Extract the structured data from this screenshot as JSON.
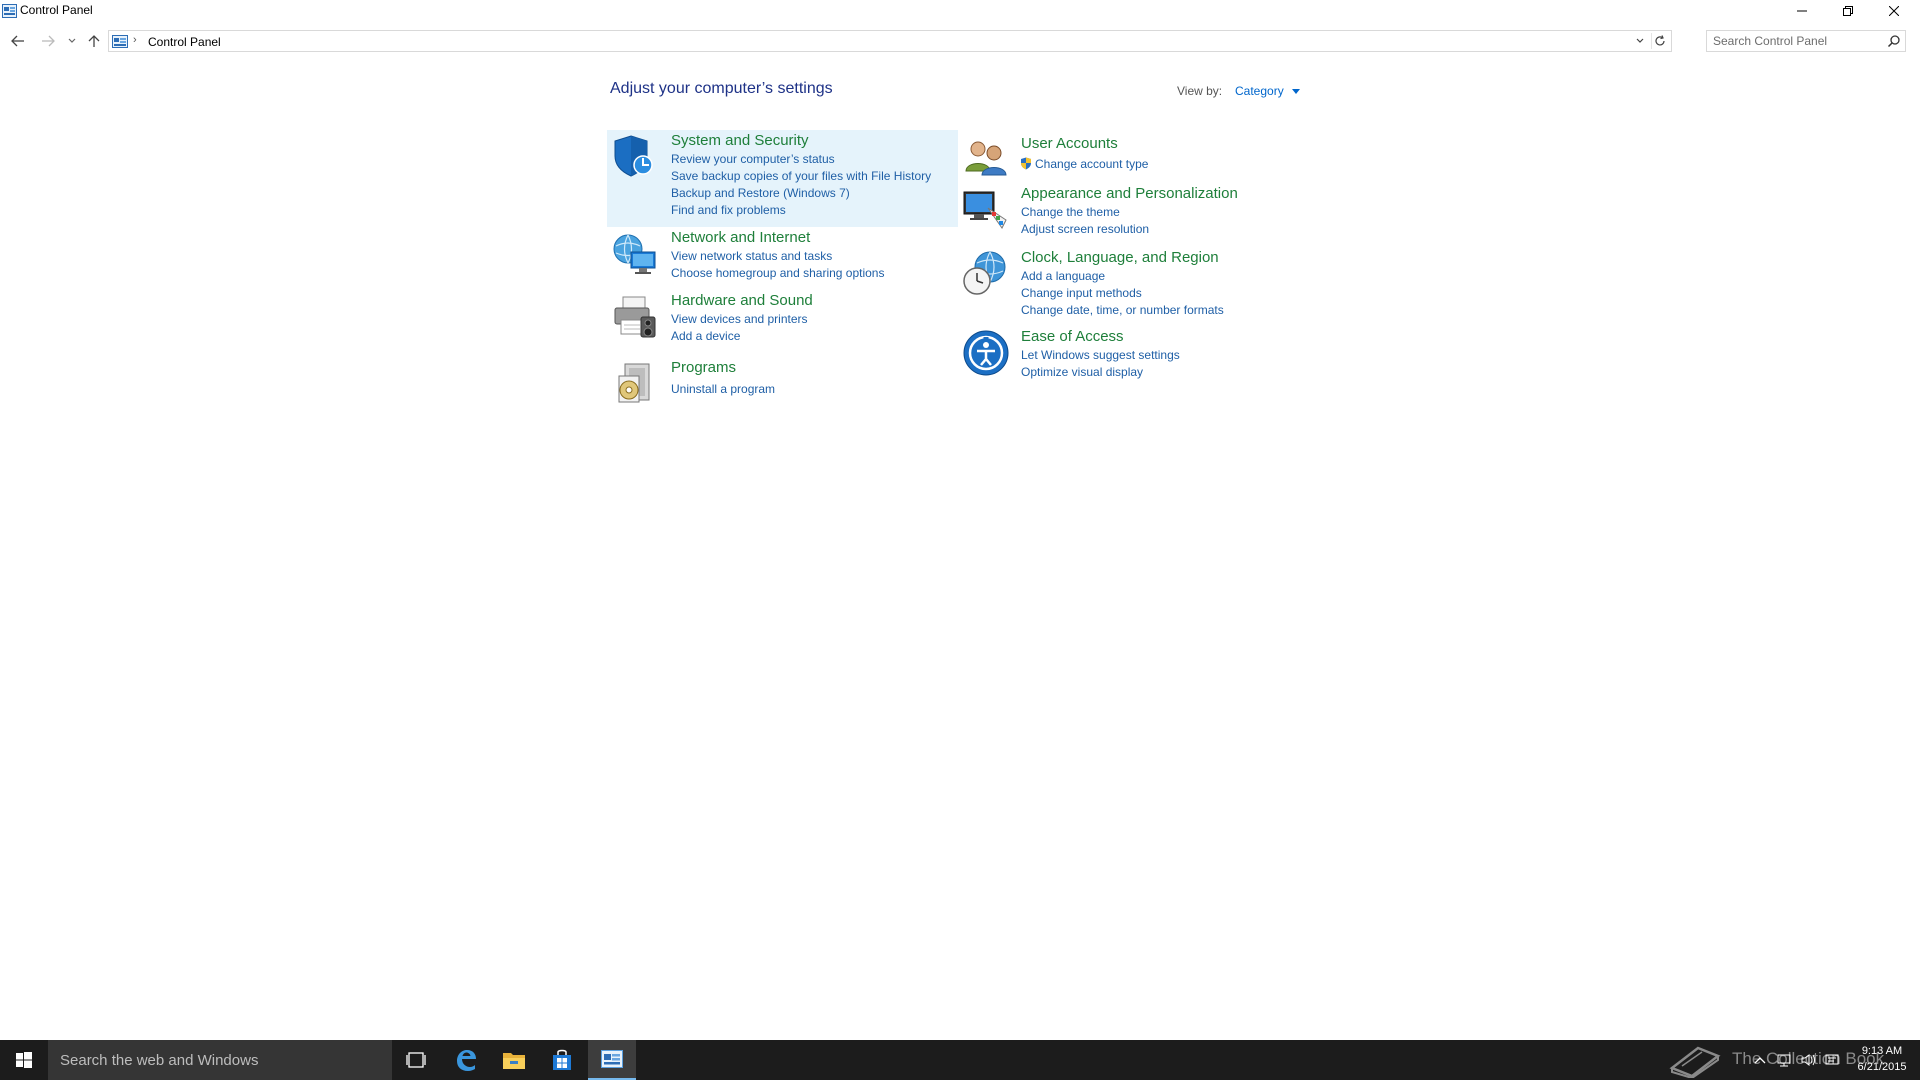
{
  "window": {
    "title": "Control Panel"
  },
  "address": {
    "crumb": "Control Panel",
    "search_placeholder": "Search Control Panel"
  },
  "main": {
    "heading": "Adjust your computer’s settings",
    "view_by_label": "View by:",
    "view_by_value": "Category",
    "categories": [
      {
        "title": "System and Security",
        "icon": "system-security-shield-icon",
        "links": [
          "Review your computer’s status",
          "Save backup copies of your files with File History",
          "Backup and Restore (Windows 7)",
          "Find and fix problems"
        ]
      },
      {
        "title": "Network and Internet",
        "icon": "network-globe-icon",
        "links": [
          "View network status and tasks",
          "Choose homegroup and sharing options"
        ]
      },
      {
        "title": "Hardware and Sound",
        "icon": "printer-speaker-icon",
        "links": [
          "View devices and printers",
          "Add a device"
        ]
      },
      {
        "title": "Programs",
        "icon": "programs-disc-icon",
        "links": [
          "Uninstall a program"
        ]
      },
      {
        "title": "User Accounts",
        "icon": "users-icon",
        "links": [
          "Change account type"
        ]
      },
      {
        "title": "Appearance and Personalization",
        "icon": "monitor-palette-icon",
        "links": [
          "Change the theme",
          "Adjust screen resolution"
        ]
      },
      {
        "title": "Clock, Language, and Region",
        "icon": "clock-globe-icon",
        "links": [
          "Add a language",
          "Change input methods",
          "Change date, time, or number formats"
        ]
      },
      {
        "title": "Ease of Access",
        "icon": "ease-of-access-icon",
        "links": [
          "Let Windows suggest settings",
          "Optimize visual display"
        ]
      }
    ]
  },
  "taskbar": {
    "search_text": "Search the web and Windows",
    "watermark_text": "The Collection Book",
    "time": "9:13 AM",
    "date": "6/21/2015"
  },
  "colors": {
    "heading": "#1e3287",
    "category_title": "#1e7f3a",
    "link": "#1f5fa6",
    "highlight": "#e5f3fb",
    "taskbar": "#1c1c1c"
  }
}
